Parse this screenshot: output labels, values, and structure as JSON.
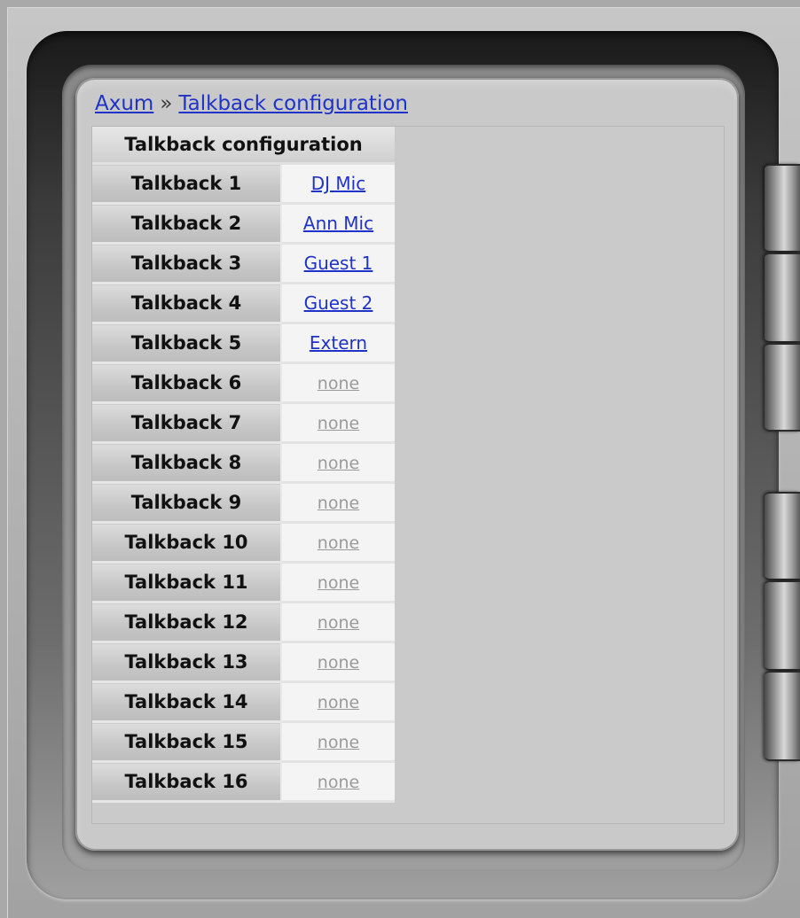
{
  "breadcrumb": {
    "home_label": "Axum",
    "separator": "»",
    "current_label": "Talkback configuration"
  },
  "table": {
    "header": "Talkback configuration",
    "rows": [
      {
        "label": "Talkback 1",
        "value": "DJ Mic",
        "assigned": true
      },
      {
        "label": "Talkback 2",
        "value": "Ann Mic",
        "assigned": true
      },
      {
        "label": "Talkback 3",
        "value": "Guest 1",
        "assigned": true
      },
      {
        "label": "Talkback 4",
        "value": "Guest 2",
        "assigned": true
      },
      {
        "label": "Talkback 5",
        "value": "Extern",
        "assigned": true
      },
      {
        "label": "Talkback 6",
        "value": "none",
        "assigned": false
      },
      {
        "label": "Talkback 7",
        "value": "none",
        "assigned": false
      },
      {
        "label": "Talkback 8",
        "value": "none",
        "assigned": false
      },
      {
        "label": "Talkback 9",
        "value": "none",
        "assigned": false
      },
      {
        "label": "Talkback 10",
        "value": "none",
        "assigned": false
      },
      {
        "label": "Talkback 11",
        "value": "none",
        "assigned": false
      },
      {
        "label": "Talkback 12",
        "value": "none",
        "assigned": false
      },
      {
        "label": "Talkback 13",
        "value": "none",
        "assigned": false
      },
      {
        "label": "Talkback 14",
        "value": "none",
        "assigned": false
      },
      {
        "label": "Talkback 15",
        "value": "none",
        "assigned": false
      },
      {
        "label": "Talkback 16",
        "value": "none",
        "assigned": false
      }
    ]
  },
  "colors": {
    "link": "#1f33c8",
    "empty_link": "#9a9a9a"
  }
}
